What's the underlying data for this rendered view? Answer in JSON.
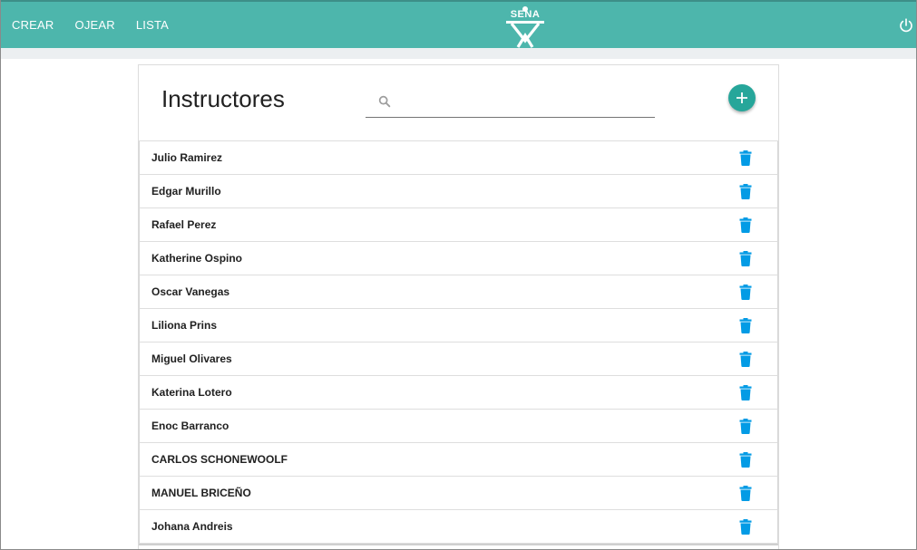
{
  "nav": {
    "items": [
      {
        "label": "CREAR"
      },
      {
        "label": "OJEAR"
      },
      {
        "label": "LISTA"
      }
    ]
  },
  "logo": {
    "text": "SENA"
  },
  "header": {
    "title": "Instructores",
    "search_placeholder": ""
  },
  "instructors": [
    {
      "name": "Julio Ramirez"
    },
    {
      "name": "Edgar Murillo"
    },
    {
      "name": "Rafael Perez"
    },
    {
      "name": "Katherine Ospino"
    },
    {
      "name": "Oscar Vanegas"
    },
    {
      "name": "Liliona Prins"
    },
    {
      "name": "Miguel Olivares"
    },
    {
      "name": "Katerina Lotero"
    },
    {
      "name": "Enoc Barranco"
    },
    {
      "name": "CARLOS SCHONEWOOLF"
    },
    {
      "name": "MANUEL BRICEÑO"
    },
    {
      "name": "Johana Andreis"
    }
  ],
  "icons": {
    "power": "power-icon",
    "search": "search-icon",
    "add": "plus-icon",
    "delete": "trash-icon"
  },
  "colors": {
    "topbar": "#4db6ac",
    "fab": "#26a69a",
    "delete_icon": "#039be5"
  }
}
